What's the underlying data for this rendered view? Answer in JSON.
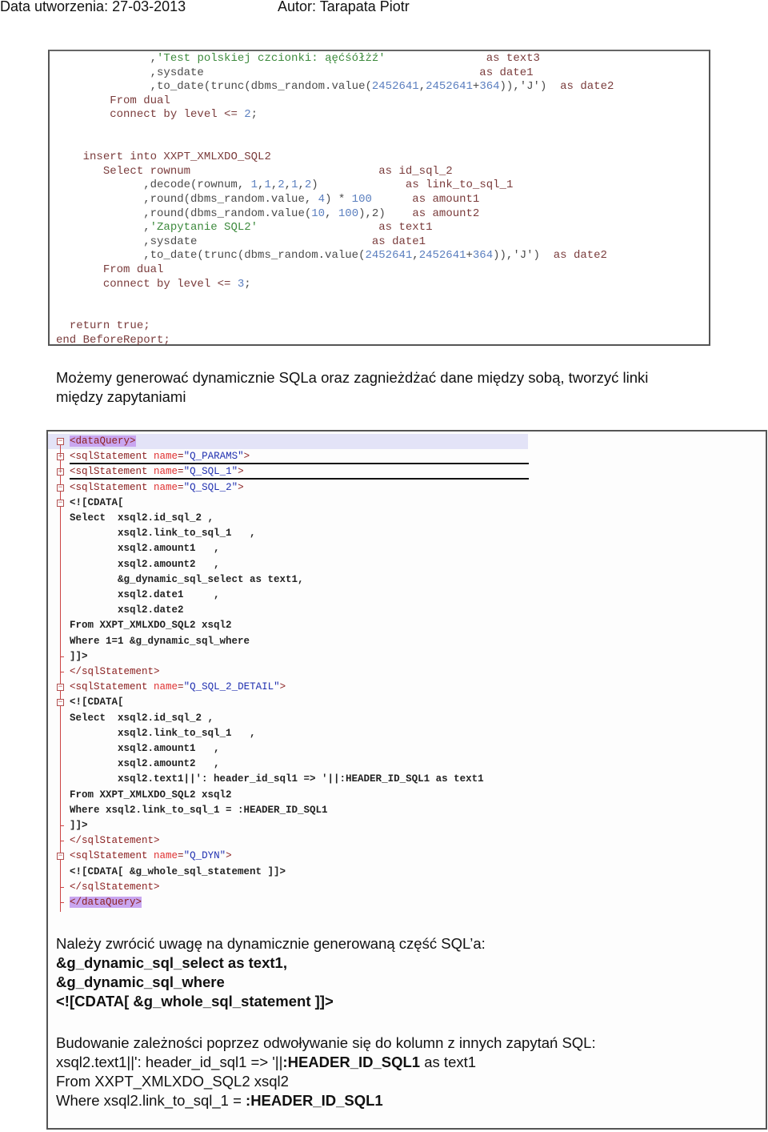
{
  "header": {
    "created": "Data utworzenia: 27-03-2013",
    "author": "Autor: Tarapata Piotr"
  },
  "code_block_1": {
    "lines": [
      {
        "indent": "              ",
        "parts": [
          {
            "t": ",",
            "c": "plain"
          },
          {
            "t": "'Test polskiej czcionki: ąęćśółżź'",
            "c": "str"
          },
          {
            "t": "               as text3",
            "c": "kw"
          }
        ]
      },
      {
        "indent": "              ",
        "parts": [
          {
            "t": ",sysdate",
            "c": "plain"
          },
          {
            "t": "                                         as date1",
            "c": "kw"
          }
        ]
      },
      {
        "indent": "              ",
        "parts": [
          {
            "t": ",to_date(trunc(dbms_random.value(",
            "c": "plain"
          },
          {
            "t": "2452641",
            "c": "num"
          },
          {
            "t": ",",
            "c": "plain"
          },
          {
            "t": "2452641",
            "c": "num"
          },
          {
            "t": "+",
            "c": "plain"
          },
          {
            "t": "364",
            "c": "num"
          },
          {
            "t": ")),'J')  ",
            "c": "plain"
          },
          {
            "t": "as date2",
            "c": "kw"
          }
        ]
      },
      {
        "indent": "        ",
        "parts": [
          {
            "t": "From dual",
            "c": "kw"
          }
        ]
      },
      {
        "indent": "        ",
        "parts": [
          {
            "t": "connect by level <= ",
            "c": "kw"
          },
          {
            "t": "2",
            "c": "num"
          },
          {
            "t": ";",
            "c": "plain"
          }
        ]
      },
      {
        "indent": "",
        "parts": []
      },
      {
        "indent": "",
        "parts": []
      },
      {
        "indent": "    ",
        "parts": [
          {
            "t": "insert into XXPT_XMLXDO_SQL2",
            "c": "kw"
          }
        ]
      },
      {
        "indent": "       ",
        "parts": [
          {
            "t": "Select rownum",
            "c": "kw"
          },
          {
            "t": "                            as id_sql_2",
            "c": "kw"
          }
        ]
      },
      {
        "indent": "             ",
        "parts": [
          {
            "t": ",decode(rownum, ",
            "c": "plain"
          },
          {
            "t": "1",
            "c": "num"
          },
          {
            "t": ",",
            "c": "plain"
          },
          {
            "t": "1",
            "c": "num"
          },
          {
            "t": ",",
            "c": "plain"
          },
          {
            "t": "2",
            "c": "num"
          },
          {
            "t": ",",
            "c": "plain"
          },
          {
            "t": "1",
            "c": "num"
          },
          {
            "t": ",",
            "c": "plain"
          },
          {
            "t": "2",
            "c": "num"
          },
          {
            "t": ")",
            "c": "plain"
          },
          {
            "t": "             as link_to_sql_1",
            "c": "kw"
          }
        ]
      },
      {
        "indent": "             ",
        "parts": [
          {
            "t": ",round(dbms_random.value, ",
            "c": "plain"
          },
          {
            "t": "4",
            "c": "num"
          },
          {
            "t": ") * ",
            "c": "plain"
          },
          {
            "t": "100",
            "c": "num"
          },
          {
            "t": "      as amount1",
            "c": "kw"
          }
        ]
      },
      {
        "indent": "             ",
        "parts": [
          {
            "t": ",round(dbms_random.value(",
            "c": "plain"
          },
          {
            "t": "10",
            "c": "num"
          },
          {
            "t": ", ",
            "c": "plain"
          },
          {
            "t": "100",
            "c": "num"
          },
          {
            "t": "),2)",
            "c": "plain"
          },
          {
            "t": "    as amount2",
            "c": "kw"
          }
        ]
      },
      {
        "indent": "             ",
        "parts": [
          {
            "t": ",",
            "c": "plain"
          },
          {
            "t": "'Zapytanie SQL2'",
            "c": "str"
          },
          {
            "t": "                  as text1",
            "c": "kw"
          }
        ]
      },
      {
        "indent": "             ",
        "parts": [
          {
            "t": ",sysdate",
            "c": "plain"
          },
          {
            "t": "                          as date1",
            "c": "kw"
          }
        ]
      },
      {
        "indent": "             ",
        "parts": [
          {
            "t": ",to_date(trunc(dbms_random.value(",
            "c": "plain"
          },
          {
            "t": "2452641",
            "c": "num"
          },
          {
            "t": ",",
            "c": "plain"
          },
          {
            "t": "2452641",
            "c": "num"
          },
          {
            "t": "+",
            "c": "plain"
          },
          {
            "t": "364",
            "c": "num"
          },
          {
            "t": ")),'J')  ",
            "c": "plain"
          },
          {
            "t": "as date2",
            "c": "kw"
          }
        ]
      },
      {
        "indent": "       ",
        "parts": [
          {
            "t": "From dual",
            "c": "kw"
          }
        ]
      },
      {
        "indent": "       ",
        "parts": [
          {
            "t": "connect by level <= ",
            "c": "kw"
          },
          {
            "t": "3",
            "c": "num"
          },
          {
            "t": ";",
            "c": "plain"
          }
        ]
      },
      {
        "indent": "",
        "parts": []
      },
      {
        "indent": "",
        "parts": []
      },
      {
        "indent": "  ",
        "parts": [
          {
            "t": "return true;",
            "c": "kw"
          }
        ]
      },
      {
        "indent": "",
        "parts": [
          {
            "t": "end BeforeReport;",
            "c": "kw"
          }
        ]
      }
    ]
  },
  "paragraph_1": {
    "line1": "Możemy generować dynamicznie SQLa oraz zagnieżdżać dane między sobą, tworzyć linki",
    "line2": "między zapytaniami"
  },
  "xml_block": {
    "lines": [
      {
        "fold": "minus",
        "parts": [
          {
            "t": "<dataQuery>",
            "c": "tag hl"
          }
        ]
      },
      {
        "fold": "plus",
        "parts": [
          {
            "t": "<sqlStatement ",
            "c": "tag"
          },
          {
            "t": "name",
            "c": "attr"
          },
          {
            "t": "=",
            "c": "tag"
          },
          {
            "t": "\"Q_PARAMS\"",
            "c": "val"
          },
          {
            "t": ">",
            "c": "tag"
          }
        ]
      },
      {
        "fold": "plus",
        "parts": [
          {
            "t": "<sqlStatement ",
            "c": "tag"
          },
          {
            "t": "name",
            "c": "attr"
          },
          {
            "t": "=",
            "c": "tag"
          },
          {
            "t": "\"Q_SQL_1\"",
            "c": "val"
          },
          {
            "t": ">",
            "c": "tag"
          }
        ]
      },
      {
        "fold": "minus",
        "parts": [
          {
            "t": "<sqlStatement ",
            "c": "tag"
          },
          {
            "t": "name",
            "c": "attr"
          },
          {
            "t": "=",
            "c": "tag"
          },
          {
            "t": "\"Q_SQL_2\"",
            "c": "val"
          },
          {
            "t": ">",
            "c": "tag"
          }
        ]
      },
      {
        "fold": "minus",
        "parts": [
          {
            "t": "<![CDATA[",
            "c": "cdata"
          }
        ]
      },
      {
        "fold": "",
        "parts": [
          {
            "t": "Select  xsql2.id_sql_2 ,",
            "c": "cdata"
          }
        ]
      },
      {
        "fold": "",
        "parts": [
          {
            "t": "        xsql2.link_to_sql_1   ,",
            "c": "cdata"
          }
        ]
      },
      {
        "fold": "",
        "parts": [
          {
            "t": "        xsql2.amount1   ,",
            "c": "cdata"
          }
        ]
      },
      {
        "fold": "",
        "parts": [
          {
            "t": "        xsql2.amount2   ,",
            "c": "cdata"
          }
        ]
      },
      {
        "fold": "",
        "parts": [
          {
            "t": "        &g_dynamic_sql_select as text1,",
            "c": "cdata"
          }
        ]
      },
      {
        "fold": "",
        "parts": [
          {
            "t": "        xsql2.date1     ,",
            "c": "cdata"
          }
        ]
      },
      {
        "fold": "",
        "parts": [
          {
            "t": "        xsql2.date2",
            "c": "cdata"
          }
        ]
      },
      {
        "fold": "",
        "parts": [
          {
            "t": "From XXPT_XMLXDO_SQL2 xsql2",
            "c": "cdata"
          }
        ]
      },
      {
        "fold": "",
        "parts": [
          {
            "t": "Where 1=1 &g_dynamic_sql_where",
            "c": "cdata"
          }
        ]
      },
      {
        "fold": "tick",
        "parts": [
          {
            "t": "]]>",
            "c": "cdata"
          }
        ]
      },
      {
        "fold": "tick",
        "parts": [
          {
            "t": "</sqlStatement>",
            "c": "tag"
          }
        ]
      },
      {
        "fold": "minus",
        "parts": [
          {
            "t": "<sqlStatement ",
            "c": "tag"
          },
          {
            "t": "name",
            "c": "attr"
          },
          {
            "t": "=",
            "c": "tag"
          },
          {
            "t": "\"Q_SQL_2_DETAIL\"",
            "c": "val"
          },
          {
            "t": ">",
            "c": "tag"
          }
        ]
      },
      {
        "fold": "minus",
        "parts": [
          {
            "t": "<![CDATA[",
            "c": "cdata"
          }
        ]
      },
      {
        "fold": "",
        "parts": [
          {
            "t": "Select  xsql2.id_sql_2 ,",
            "c": "cdata"
          }
        ]
      },
      {
        "fold": "",
        "parts": [
          {
            "t": "        xsql2.link_to_sql_1   ,",
            "c": "cdata"
          }
        ]
      },
      {
        "fold": "",
        "parts": [
          {
            "t": "        xsql2.amount1   ,",
            "c": "cdata"
          }
        ]
      },
      {
        "fold": "",
        "parts": [
          {
            "t": "        xsql2.amount2   ,",
            "c": "cdata"
          }
        ]
      },
      {
        "fold": "",
        "parts": [
          {
            "t": "        xsql2.text1||': header_id_sql1 => '||:HEADER_ID_SQL1 as text1",
            "c": "cdata"
          }
        ]
      },
      {
        "fold": "",
        "parts": [
          {
            "t": "From XXPT_XMLXDO_SQL2 xsql2",
            "c": "cdata"
          }
        ]
      },
      {
        "fold": "",
        "parts": [
          {
            "t": "Where xsql2.link_to_sql_1 = :HEADER_ID_SQL1",
            "c": "cdata"
          }
        ]
      },
      {
        "fold": "tick",
        "parts": [
          {
            "t": "]]>",
            "c": "cdata"
          }
        ]
      },
      {
        "fold": "tick",
        "parts": [
          {
            "t": "</sqlStatement>",
            "c": "tag"
          }
        ]
      },
      {
        "fold": "minus",
        "parts": [
          {
            "t": "<sqlStatement ",
            "c": "tag"
          },
          {
            "t": "name",
            "c": "attr"
          },
          {
            "t": "=",
            "c": "tag"
          },
          {
            "t": "\"Q_DYN\"",
            "c": "val"
          },
          {
            "t": ">",
            "c": "tag"
          }
        ]
      },
      {
        "fold": "",
        "parts": [
          {
            "t": "<![CDATA[ &g_whole_sql_statement ]]>",
            "c": "cdata"
          }
        ]
      },
      {
        "fold": "tick",
        "parts": [
          {
            "t": "</sqlStatement>",
            "c": "tag"
          }
        ]
      },
      {
        "fold": "tick",
        "parts": [
          {
            "t": "</dataQuery>",
            "c": "tag hl"
          }
        ]
      }
    ]
  },
  "paragraph_2": {
    "intro": "Należy zwrócić uwagę na dynamicznie generowaną część SQL’a:",
    "lines": [
      "&g_dynamic_sql_select as text1,",
      "&g_dynamic_sql_where",
      "<![CDATA[ &g_whole_sql_statement ]]>"
    ]
  },
  "paragraph_3": {
    "intro": "Budowanie zależności poprzez odwoływanie się do kolumn z innych zapytań SQL:",
    "line1_a": "xsql2.text1||': header_id_sql1 => '||",
    "line1_b": ":HEADER_ID_SQL1",
    "line1_c": " as text1",
    "line2": "From XXPT_XMLXDO_SQL2 xsql2",
    "line3_a": "Where xsql2.link_to_sql_1 = ",
    "line3_b": ":HEADER_ID_SQL1"
  }
}
